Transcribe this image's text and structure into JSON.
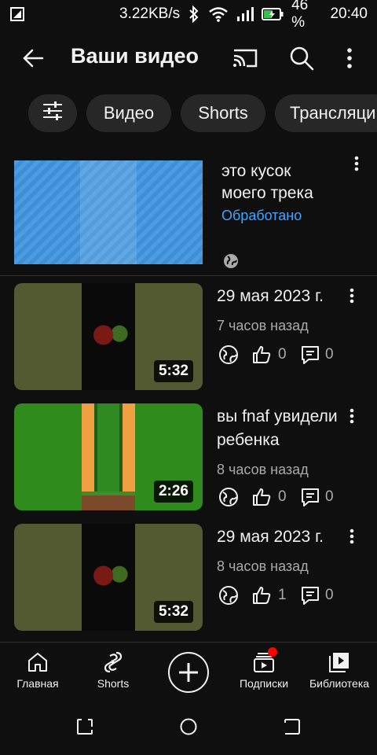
{
  "status_bar": {
    "net_speed": "3.22KB/s",
    "battery": "46 %",
    "time": "20:40"
  },
  "header": {
    "title": "Ваши видео"
  },
  "chips": [
    {
      "label": "Видео"
    },
    {
      "label": "Shorts"
    },
    {
      "label": "Трансляци"
    }
  ],
  "processing_item": {
    "title": "это кусок моего трека",
    "status": "Обработано"
  },
  "videos": [
    {
      "title": "29 мая 2023 г.",
      "time_ago": "7 часов назад",
      "duration": "5:32",
      "likes": "0",
      "comments": "0"
    },
    {
      "title": "вы fnaf увидели ребенка",
      "time_ago": "8 часов назад",
      "duration": "2:26",
      "likes": "0",
      "comments": "0"
    },
    {
      "title": "29 мая 2023 г.",
      "time_ago": "8 часов назад",
      "duration": "5:32",
      "likes": "1",
      "comments": "0"
    }
  ],
  "bottom_nav": [
    {
      "label": "Главная"
    },
    {
      "label": "Shorts"
    },
    {
      "label": "Подписки"
    },
    {
      "label": "Библиотека"
    }
  ],
  "colors": {
    "background": "#0f0f0f",
    "chip": "#272727",
    "link_blue": "#3ea6ff",
    "secondary_text": "#aaaaaa",
    "notification_red": "#ff0000"
  }
}
